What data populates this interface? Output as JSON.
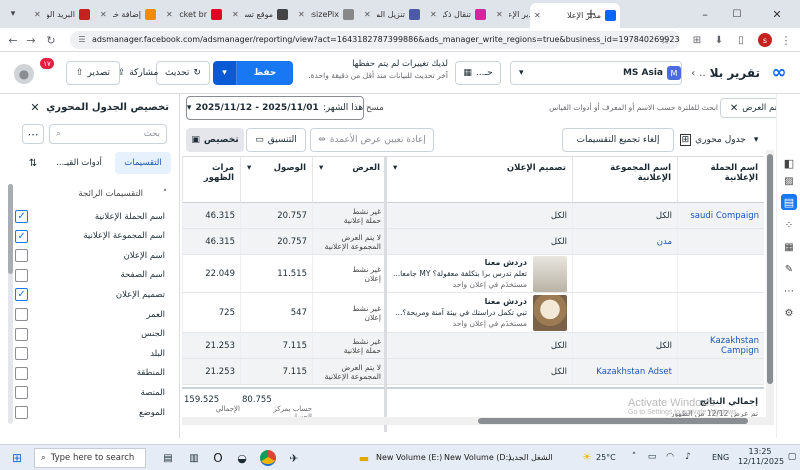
{
  "tabs": [
    {
      "label": "البريد الو",
      "color": "#c5221f"
    },
    {
      "label": "إضافة خدمة",
      "color": "#f28b00"
    },
    {
      "label": "Rocket br",
      "color": "#e60023"
    },
    {
      "label": "موقع تسـ",
      "color": "#444444"
    },
    {
      "label": "ResizePix",
      "color": "#888888"
    },
    {
      "label": "تنزيل الملـ",
      "color": "#4a5aa8"
    },
    {
      "label": "تنقال ذكية",
      "color": "#d6249f"
    },
    {
      "label": "مدير الإعلا",
      "color": "#0866ff"
    },
    {
      "label": "مدير الإعلا",
      "color": "#0866ff"
    }
  ],
  "browser": {
    "url": "adsmanager.facebook.com/adsmanager/reporting/view?act=1643182787399886&ads_manager_write_regions=true&business_id=197840269923467...",
    "profile": "s"
  },
  "header": {
    "title": "تقرير بلا",
    "title_suffix": "..",
    "account": "MS Asia",
    "account_badge": "M",
    "tabs_label": "حـ...",
    "unsaved_line1": "لديك تغييرات لم يتم حفظها",
    "unsaved_line2": "آخر تحديث للبيانات منذ أقل من دقيقة واحدة.",
    "save_label": "حفظ",
    "refresh_label": "تحديث",
    "share_label": "مشاركة",
    "export_label": "تصدير",
    "notif_count": "١٧"
  },
  "filter": {
    "chip": "تم العرض",
    "placeholder": "ابحث للفلترة حسب الاسم أو المعرف أو أدوات القياس",
    "clear": "مسح",
    "date_label": "هذا الشهر:",
    "date_range": "2025/11/01 - 2025/11/12"
  },
  "toolbar": {
    "pivot": "جدول محوري",
    "remove_grouping": "إلغاء تجميع التقسيمات",
    "reset_width": "إعادة تعيين عرض الأعمدة",
    "format": "التنسيق",
    "customize": "تخصيص"
  },
  "table": {
    "headers": {
      "campaign": "اسم الحملة الإعلانية",
      "adset": "اسم المجموعة الإعلانية",
      "design": "تصميم الإعلان",
      "delivery": "العرض",
      "reach": "الوصول",
      "impressions": "مرات الظهور"
    },
    "rows": [
      {
        "campaign": "saudi Compaign",
        "adset": "الكل",
        "design": "الكل",
        "status1": "غير نشط",
        "status2": "حملة إعلانية",
        "reach": "20.757",
        "impressions": "46.315"
      },
      {
        "campaign": "",
        "adset": "مدن",
        "design": "الكل",
        "status1": "لا يتم العرض",
        "status2": "المجموعة الإعلانية",
        "reach": "20.757",
        "impressions": "46.315"
      },
      {
        "ad_title": "دردش معنا",
        "ad_desc": "تعلم تدرس برا بتكلفة معقولة؟ MY جامعا...",
        "ad_meta": "مستخدَم في إعلان واحد",
        "status1": "غير نشط",
        "status2": "إعلان",
        "reach": "11.515",
        "impressions": "22.049"
      },
      {
        "ad_title": "دردش معنا",
        "ad_desc": "تبي تكمل دراستك في بيئة آمنة ومريحة؟...",
        "ad_meta": "مستخدَم في إعلان واحد",
        "status1": "غير نشط",
        "status2": "إعلان",
        "reach": "547",
        "impressions": "725"
      },
      {
        "campaign": "Kazakhstan Campign",
        "adset": "الكل",
        "design": "الكل",
        "status1": "غير نشط",
        "status2": "حملة إعلانية",
        "reach": "7.115",
        "impressions": "21.253"
      },
      {
        "campaign": "",
        "adset": "Kazakhstan Adset",
        "design": "الكل",
        "status1": "لا يتم العرض",
        "status2": "المجموعة الإعلانية",
        "reach": "7.115",
        "impressions": "21.253"
      }
    ],
    "totals": {
      "label": "إجمالي النتائج",
      "sub": "تم عرض 12/12 من الظهور",
      "reach": "80.755",
      "reach_sub": "حساب بمركز الحساب...",
      "impressions": "159.525",
      "impressions_sub": "الإجمالي"
    }
  },
  "sidebar": {
    "title": "تخصيص الجدول المحوري",
    "search_placeholder": "بحث",
    "tab_breakdowns": "التقسيمات",
    "tab_tools": "أدوات القيـ...",
    "section": "التقسيمات الرائجة",
    "options": [
      {
        "label": "اسم الحملة الإعلانية",
        "checked": true
      },
      {
        "label": "اسم المجموعة الإعلانية",
        "checked": true
      },
      {
        "label": "اسم الإعلان",
        "checked": false
      },
      {
        "label": "اسم الصفحة",
        "checked": false
      },
      {
        "label": "تصميم الإعلان",
        "checked": true
      },
      {
        "label": "العمر",
        "checked": false
      },
      {
        "label": "الجنس",
        "checked": false
      },
      {
        "label": "البلد",
        "checked": false
      },
      {
        "label": "المنطقة",
        "checked": false
      },
      {
        "label": "المنصة",
        "checked": false
      },
      {
        "label": "الموضع",
        "checked": false
      }
    ]
  },
  "watermark": {
    "line1": "Activate Windows",
    "line2": "Go to Settings to activate Windows."
  },
  "taskbar": {
    "search": "Type here to search",
    "vol1": "New Volume (E:)",
    "vol2": "New Volume (D:)",
    "folder": "الشغل الجديد",
    "temp": "25°C",
    "lang": "ENG",
    "time": "13:25",
    "date": "12/11/2025"
  }
}
